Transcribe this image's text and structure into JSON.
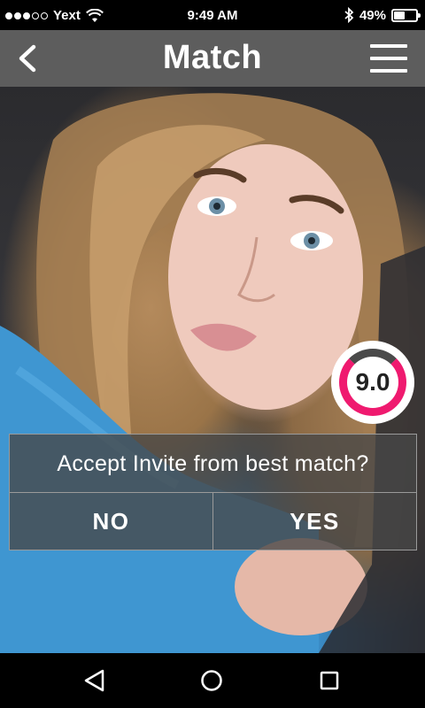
{
  "status_bar": {
    "carrier": "Yext",
    "time": "9:49 AM",
    "battery_text": "49%",
    "battery_level": 0.49
  },
  "header": {
    "title": "Match",
    "back_icon": "chevron-left-icon",
    "menu_icon": "hamburger-menu-icon"
  },
  "profile": {
    "score": "9.0",
    "score_fraction": 0.9,
    "ring_color": "#ef1a6f"
  },
  "dialog": {
    "message": "Accept Invite from best match?",
    "no_label": "NO",
    "yes_label": "YES"
  },
  "nav": {
    "back_icon": "triangle-back-icon",
    "home_icon": "circle-home-icon",
    "recents_icon": "square-recents-icon"
  }
}
